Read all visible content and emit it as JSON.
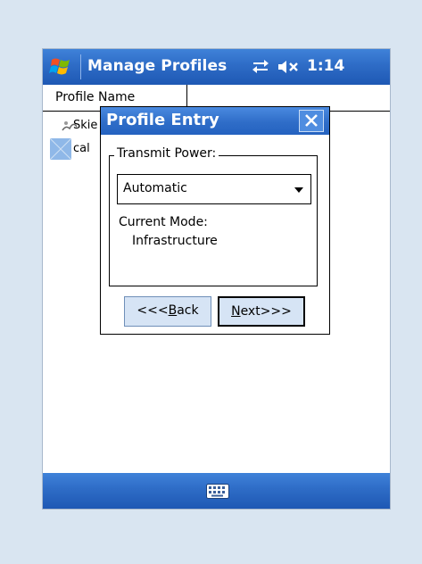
{
  "titlebar": {
    "title": "Manage Profiles",
    "clock": "1:14",
    "icons": [
      "windows-start-icon",
      "connectivity-icon",
      "speaker-muted-icon"
    ]
  },
  "list": {
    "columns": [
      "Profile Name",
      ""
    ],
    "rows": [
      {
        "icon": "profile-icon",
        "label": "Skie"
      },
      {
        "icon": "profile-icon-selected",
        "label": "cal"
      }
    ]
  },
  "dialog": {
    "title": "Profile Entry",
    "close_icon": "close-icon",
    "group_label": "Transmit Power:",
    "power_select": {
      "value": "Automatic"
    },
    "mode_label": "Current Mode:",
    "mode_value": "Infrastructure",
    "back_prefix": "<<<",
    "back_mnemonic": "B",
    "back_rest": "ack",
    "next_mnemonic": "N",
    "next_rest": "ext>>>"
  },
  "bottombar": {
    "icon": "keyboard-icon"
  },
  "colors": {
    "titlebar": "#2e6cc6",
    "background": "#d9e5f1",
    "button_face": "#d6e4f5"
  }
}
